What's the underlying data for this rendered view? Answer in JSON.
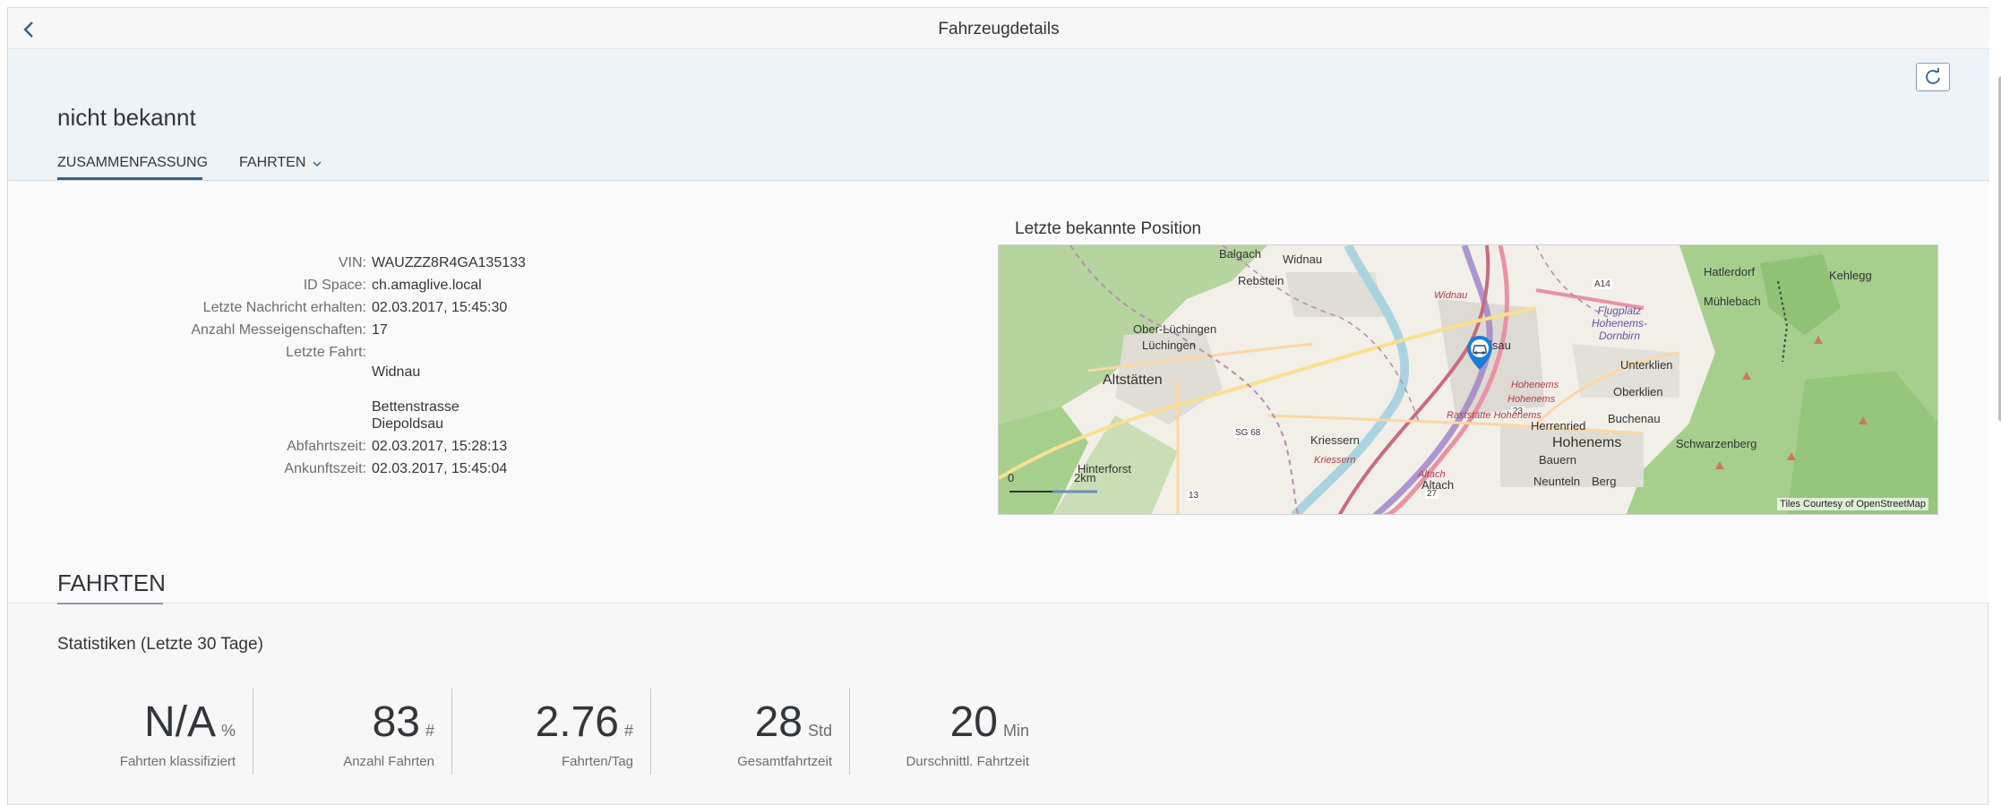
{
  "topbar": {
    "title": "Fahrzeugdetails"
  },
  "header": {
    "title": "nicht bekannt",
    "tabs": [
      {
        "label": "ZUSAMMENFASSUNG"
      },
      {
        "label": "FAHRTEN"
      }
    ]
  },
  "details": {
    "rows": [
      {
        "label": "VIN:",
        "value": "WAUZZZ8R4GA135133"
      },
      {
        "label": "ID Space:",
        "value": "ch.amaglive.local"
      },
      {
        "label": "Letzte Nachricht erhalten:",
        "value": "02.03.2017, 15:45:30"
      },
      {
        "label": "Anzahl Messeigenschaften:",
        "value": "17"
      },
      {
        "label": "Letzte Fahrt:",
        "value": ""
      }
    ],
    "trip_lines": [
      "Widnau",
      "Bettenstrasse",
      "Diepoldsau"
    ],
    "departure": {
      "label": "Abfahrtszeit:",
      "value": "02.03.2017, 15:28:13"
    },
    "arrival": {
      "label": "Ankunftszeit:",
      "value": "02.03.2017, 15:45:04"
    }
  },
  "map": {
    "title": "Letzte bekannte Position",
    "places": [
      "Balgach",
      "Widnau",
      "Rebstein",
      "Hatlerdorf",
      "Kehlegg",
      "Mühlebach",
      "Ober-Lüchingen",
      "Lüchingen",
      "Altstätten",
      "Idsau",
      "Unterklien",
      "Oberklien",
      "Herrenried",
      "Buchenau",
      "Kriessern",
      "Hohenems",
      "Schwarzenberg",
      "Bauern",
      "Hinterforst",
      "Altach",
      "Neunteln",
      "Berg"
    ],
    "road_labels": [
      "A14",
      "SG 68",
      "13",
      "23",
      "27",
      "Widnau",
      "Hohenems",
      "Raststätte Hohenems",
      "Kriessern",
      "Altach",
      "Hohenems"
    ],
    "airfield_label": "Flugplatz Hohenems-Dornbirn",
    "scale": {
      "zero": "0",
      "distance": "2km"
    },
    "attribution": "Tiles Courtesy of OpenStreetMap"
  },
  "trips_section": {
    "title": "FAHRTEN",
    "stats_title": "Statistiken (Letzte 30 Tage)",
    "kpis": [
      {
        "value": "N/A",
        "unit": "%",
        "label": "Fahrten klassifiziert"
      },
      {
        "value": "83",
        "unit": "#",
        "label": "Anzahl Fahrten"
      },
      {
        "value": "2.76",
        "unit": "#",
        "label": "Fahrten/Tag"
      },
      {
        "value": "28",
        "unit": "Std",
        "label": "Gesamtfahrtzeit"
      },
      {
        "value": "20",
        "unit": "Min",
        "label": "Durschnittl. Fahrtzeit"
      }
    ]
  },
  "colors": {
    "accent": "#346187",
    "marker": "#1c7ed6",
    "map_land": "#f2efe9",
    "map_forest": "#a6cf8e"
  }
}
